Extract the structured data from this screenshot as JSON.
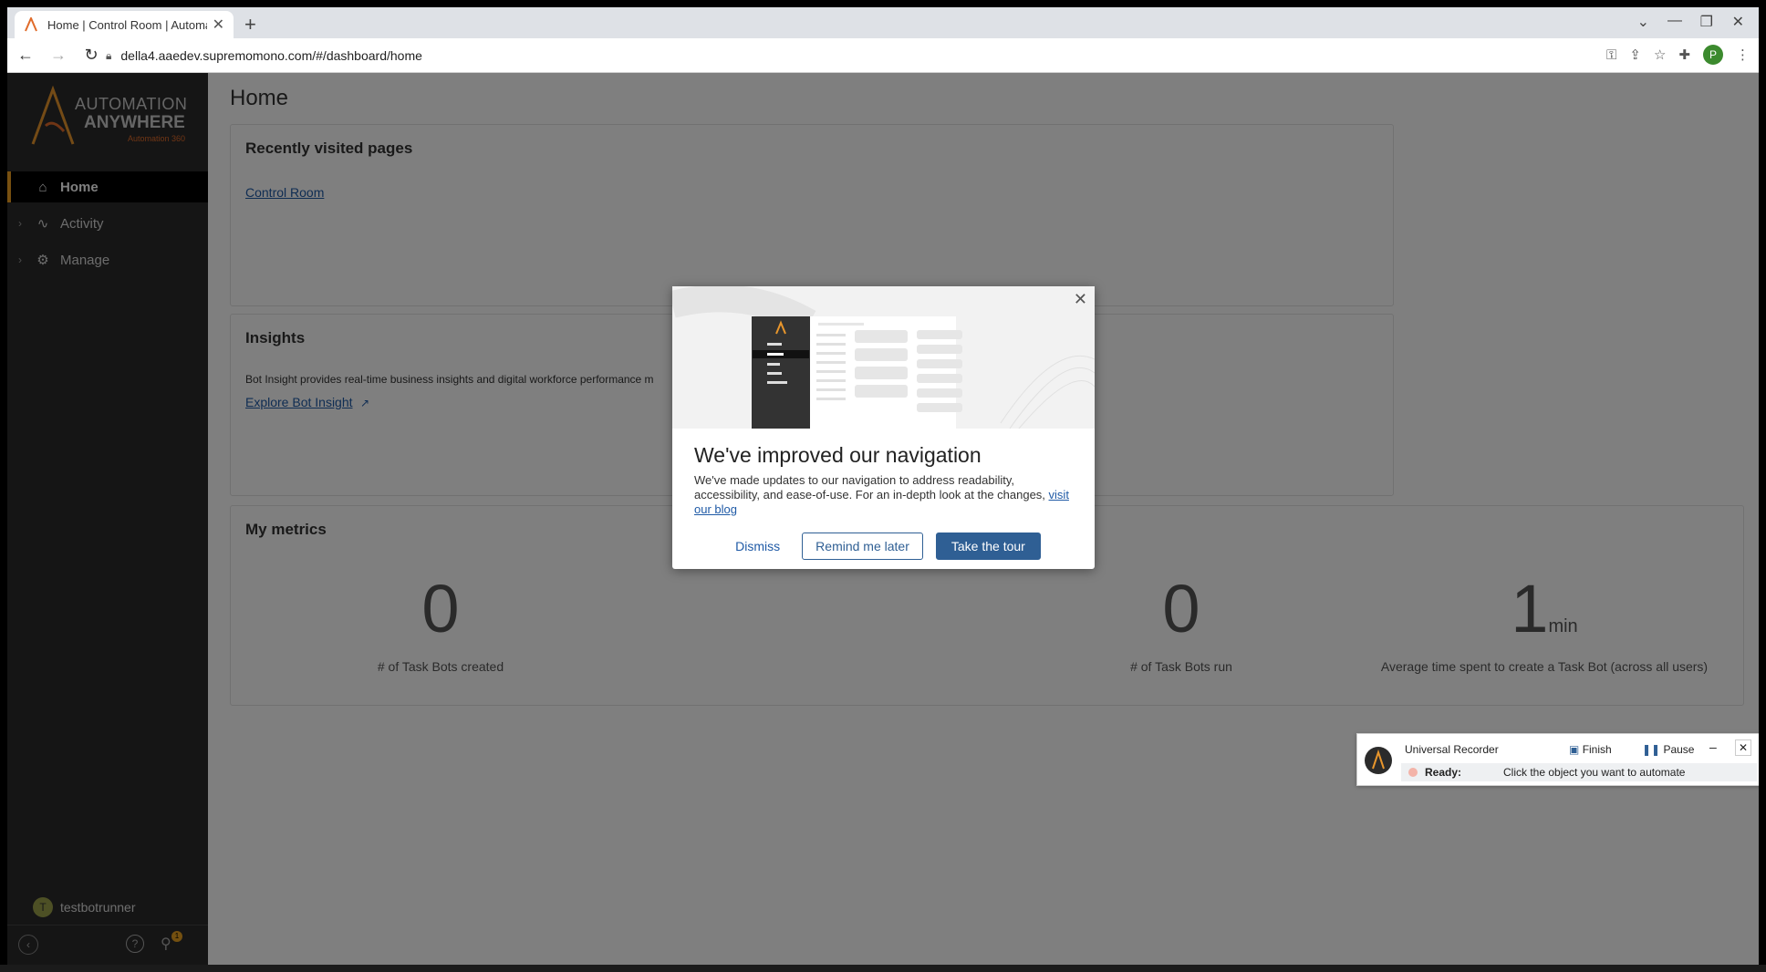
{
  "browser": {
    "tab_title": "Home | Control Room | Automat",
    "url": "della4.aaedev.supremomono.com/#/dashboard/home",
    "profile_initial": "P"
  },
  "sidebar": {
    "logo_line1": "AUTOMATION",
    "logo_line2": "ANYWHERE",
    "logo_sub": "Automation 360",
    "items": [
      {
        "label": "Home",
        "icon": "home-icon",
        "active": true
      },
      {
        "label": "Activity",
        "icon": "activity-icon",
        "active": false
      },
      {
        "label": "Manage",
        "icon": "manage-icon",
        "active": false
      }
    ],
    "user": {
      "initial": "T",
      "name": "testbotrunner"
    },
    "notification_count": "1"
  },
  "main": {
    "page_title": "Home",
    "recent": {
      "title": "Recently visited pages",
      "link": "Control Room"
    },
    "insights": {
      "title": "Insights",
      "text": "Bot Insight provides real-time business insights and digital workforce performance m",
      "link": "Explore Bot Insight"
    },
    "metrics": {
      "title": "My metrics",
      "items": [
        {
          "value": "0",
          "unit": "",
          "label": "# of Task Bots created"
        },
        {
          "value": "0",
          "unit": "",
          "label": "# of Task Bots run"
        },
        {
          "value": "1",
          "unit": "min",
          "label": "Average time spent to create a Task Bot (across all users)"
        }
      ]
    }
  },
  "modal": {
    "heading": "We've improved our navigation",
    "body": "We've made updates to our navigation to address readability, accessibility, and ease-of-use. For an in-depth look at the changes,",
    "blog_link": "visit our blog",
    "dismiss": "Dismiss",
    "remind": "Remind me later",
    "tour": "Take the tour"
  },
  "recorder": {
    "title": "Universal Recorder",
    "finish": "Finish",
    "pause": "Pause",
    "status_label": "Ready:",
    "status_text": "Click the object you want to automate"
  },
  "colors": {
    "accent": "#f0a020",
    "primary_button": "#2f5f94",
    "sidebar_bg": "#2b2b2b"
  }
}
